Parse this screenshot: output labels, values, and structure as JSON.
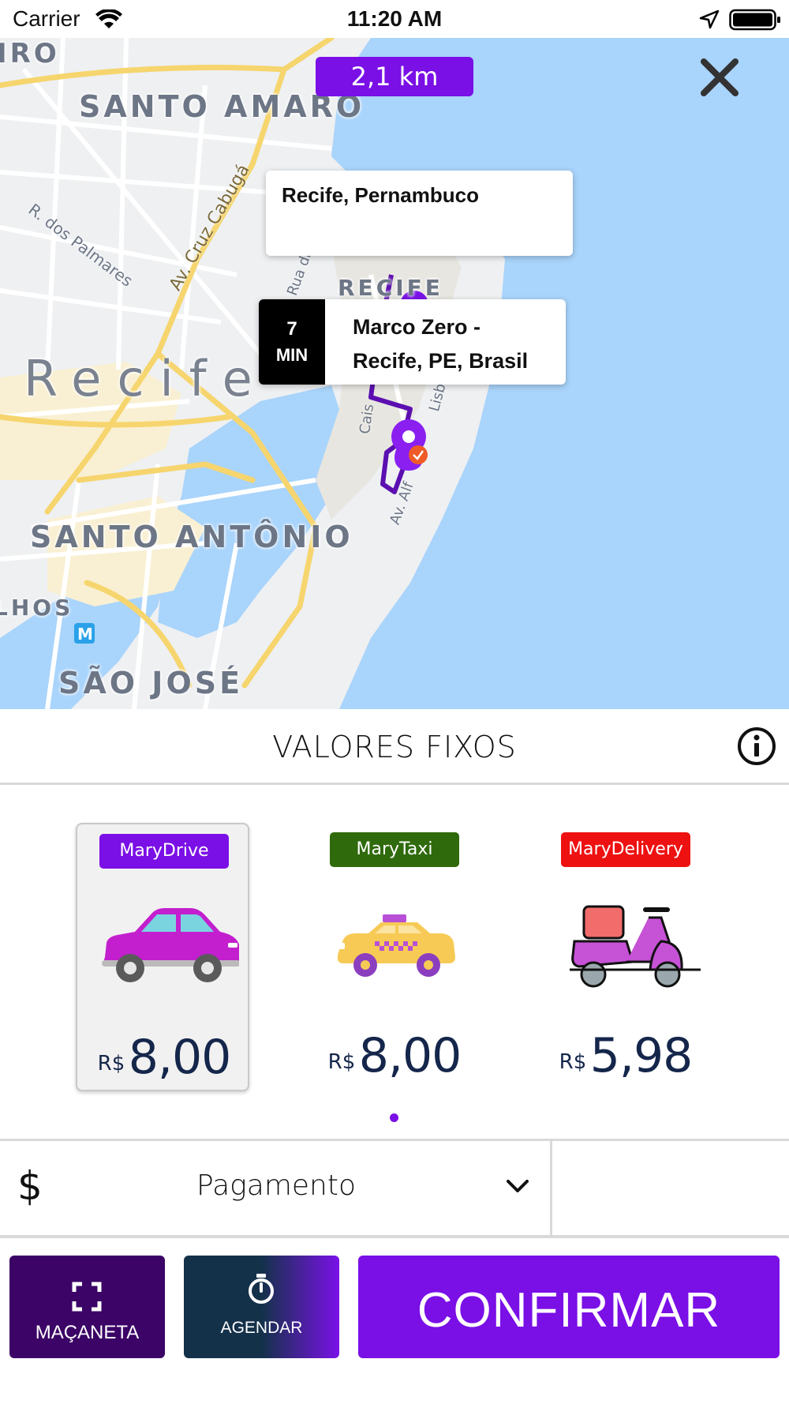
{
  "status_bar": {
    "carrier": "Carrier",
    "time": "11:20 AM"
  },
  "map": {
    "distance": "2,1 km",
    "labels": {
      "santo_amaro": "SANTO AMARO",
      "recife_city": "Recife",
      "recife_center": "RECIFE",
      "santo_antonio": "SANTO ANTÔNIO",
      "sao_jose": "SÃO JOSÉ",
      "iro": "IRO",
      "lhos": "LHOS",
      "metro": "M"
    },
    "streets": {
      "palmares": "R. dos Palmares",
      "cruz_cabuga": "Av. Cruz Cabugá",
      "aurora": "Rua da Aurora",
      "cais": "Cais",
      "lisboa": "Lisboa",
      "av_alfredo": "Av. Alf"
    },
    "origin": "Recife, Pernambuco",
    "destination": {
      "eta_value": "7",
      "eta_unit": "MIN",
      "line1": "Marco Zero -",
      "line2": "Recife, PE, Brasil"
    },
    "colors": {
      "route": "#5b0fb0",
      "water": "#a9d4fb",
      "accent": "#7a0fe6"
    }
  },
  "fixed_values": {
    "title": "VALORES FIXOS"
  },
  "options": [
    {
      "name": "MaryDrive",
      "currency": "R$",
      "price": "8,00",
      "badge_color": "#7a0fe6",
      "selected": true,
      "icon": "car-icon"
    },
    {
      "name": "MaryTaxi",
      "currency": "R$",
      "price": "8,00",
      "badge_color": "#2f6a0c",
      "selected": false,
      "icon": "taxi-icon"
    },
    {
      "name": "MaryDelivery",
      "currency": "R$",
      "price": "5,98",
      "badge_color": "#ee1111",
      "selected": false,
      "icon": "scooter-icon"
    }
  ],
  "payment": {
    "icon": "$",
    "label": "Pagamento"
  },
  "actions": {
    "macaneta": "MAÇANETA",
    "agendar": "AGENDAR",
    "confirmar": "CONFIRMAR"
  }
}
